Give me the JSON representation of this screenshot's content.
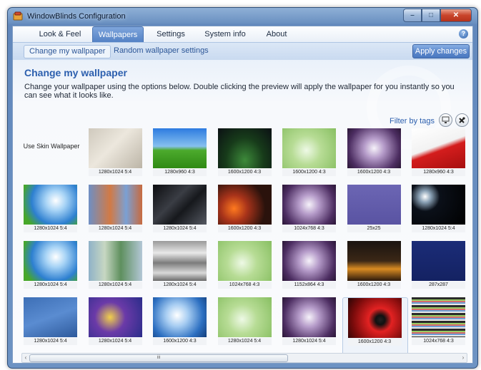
{
  "window": {
    "title": "WindowBlinds Configuration",
    "controls": {
      "minimize": "–",
      "maximize": "□",
      "close": "✕"
    }
  },
  "tabs": [
    {
      "label": "Look & Feel",
      "active": false
    },
    {
      "label": "Wallpapers",
      "active": true
    },
    {
      "label": "Settings",
      "active": false
    },
    {
      "label": "System info",
      "active": false
    },
    {
      "label": "About",
      "active": false
    }
  ],
  "help_icon": "?",
  "subtabs": [
    {
      "label": "Change my wallpaper",
      "active": true
    },
    {
      "label": "Random wallpaper settings",
      "active": false
    }
  ],
  "apply_button": "Apply changes",
  "page": {
    "title": "Change my wallpaper",
    "description": "Change your wallpaper using the options below.  Double clicking the preview will apply the wallpaper for you instantly so you can see what it looks like.",
    "filter_link": "Filter by tags",
    "tool_icons": [
      "monitor-icon",
      "tools-icon"
    ]
  },
  "skin_wallpaper_label": "Use Skin Wallpaper",
  "wallpapers": [
    {
      "size": "1280x1024 5:4",
      "fill": "linear-gradient(135deg,#cfc9bd 0%,#ece7dd 45%,#bcb5a7 100%)"
    },
    {
      "size": "1280x960 4:3",
      "fill": "linear-gradient(#2d7be0 0%,#86c0ef 45%,#4caa2d 55%,#2f8a14 100%)"
    },
    {
      "size": "1600x1200 4:3",
      "fill": "radial-gradient(ellipse at 50% 80%,#3d8a3a 0%,#173b1a 50%,#0b1014 100%)"
    },
    {
      "size": "1600x1200 4:3",
      "fill": "radial-gradient(circle at 45% 55%,#eef9e6 0%,#b7dc95 40%,#88bf62 100%)"
    },
    {
      "size": "1600x1200 4:3",
      "fill": "radial-gradient(circle at 50% 50%,#f6f2fa 0%,#b59bc9 30%,#4d2e62 75%,#2a1636 100%)"
    },
    {
      "size": "1280x960 4:3",
      "fill": "linear-gradient(160deg,#ffffff 0%,#f2f2f2 45%,#d41d1d 55%,#a60f0f 100%)"
    },
    {
      "size": "1280x1024 5:4",
      "fill": "radial-gradient(circle at 60% 40%,#ffffff 0%,#a8d4f6 25%,#2d7fd0 60%,#47a72a 85%)"
    },
    {
      "size": "1280x1024 5:4",
      "fill": "linear-gradient(90deg,#6e8fc4,#d27a45 40%,#7aa0d4 70%,#c86a3e)"
    },
    {
      "size": "1280x1024 5:4",
      "fill": "linear-gradient(135deg,#0c0d10 0%,#3a3d44 40%,#16181c 60%,#545861 100%)"
    },
    {
      "size": "1600x1200 4:3",
      "fill": "radial-gradient(circle at 30% 60%,#ff7a1f 0%,#a8331a 30%,#2a120c 70%)"
    },
    {
      "size": "1024x768 4:3",
      "fill": "radial-gradient(circle at 50% 50%,#f6f2fa 0%,#b59bc9 30%,#4d2e62 75%,#2a1636 100%)"
    },
    {
      "size": "25x25",
      "fill": "linear-gradient(#6c66b4,#5953a2)"
    },
    {
      "size": "1280x1024 5:4",
      "fill": "radial-gradient(circle at 25% 30%,#ffffff 0%,#8aa1b5 12%,#0b1019 30%,#000 100%)"
    },
    {
      "size": "1280x1024 5:4",
      "fill": "radial-gradient(circle at 60% 40%,#ffffff 0%,#a8d4f6 25%,#2d7fd0 60%,#47a72a 85%)"
    },
    {
      "size": "1280x1024 5:4",
      "fill": "linear-gradient(90deg,#8fb2c8,#c7d7c2 30%,#5e8f5e 60%,#b3c7d6)"
    },
    {
      "size": "1280x1024 5:4",
      "fill": "linear-gradient(#9a9a9a,#e8e8e8 30%,#7c7c7c 55%,#d9d9d9 80%,#6a6a6a)"
    },
    {
      "size": "1024x768 4:3",
      "fill": "radial-gradient(circle at 45% 55%,#eef9e6 0%,#b7dc95 40%,#88bf62 100%)"
    },
    {
      "size": "1152x864 4:3",
      "fill": "radial-gradient(circle at 50% 50%,#f6f2fa 0%,#b59bc9 30%,#4d2e62 75%,#2a1636 100%)"
    },
    {
      "size": "1600x1200 4:3",
      "fill": "linear-gradient(#1a1410 0%,#3b2716 50%,#d98b22 70%,#2a180c 100%)"
    },
    {
      "size": "287x287",
      "fill": "linear-gradient(#1b2c78,#142262)"
    },
    {
      "size": "1280x1024 5:4",
      "fill": "linear-gradient(160deg,#3d6fb6 0%,#5a8cd1 50%,#2e5a9c 100%)"
    },
    {
      "size": "1280x1024 5:4",
      "fill": "radial-gradient(circle at 40% 50%,#f2d04a 0%,#6b3aa8 40%,#2a2d8a 100%)"
    },
    {
      "size": "1600x1200 4:3",
      "fill": "radial-gradient(circle at 45% 45%,#ffffff 0%,#a7cdf2 30%,#2c6fc1 70%,#143e7a 100%)"
    },
    {
      "size": "1280x1024 5:4",
      "fill": "radial-gradient(circle at 45% 55%,#eef9e6 0%,#b7dc95 40%,#88bf62 100%)"
    },
    {
      "size": "1280x1024 5:4",
      "fill": "radial-gradient(circle at 50% 50%,#f6f2fa 0%,#b59bc9 30%,#4d2e62 75%,#2a1636 100%)"
    },
    {
      "size": "1600x1200 4:3",
      "fill": "radial-gradient(circle at 60% 55%,#222 0%,#111 12%,#e32222 30%,#7a0b0b 70%,#2a0505 100%)",
      "selected": true
    },
    {
      "size": "1024x768 4:3",
      "fill": "repeating-linear-gradient(#2a2a2a 0 3px,#9acb63 3px 5px,#d46b6b 5px 7px,#6e9fd6 7px 9px,#e8e8e8 9px 11px)"
    }
  ],
  "scrollbar": {
    "grip": "iii",
    "left_arrow": "‹",
    "right_arrow": "›"
  }
}
